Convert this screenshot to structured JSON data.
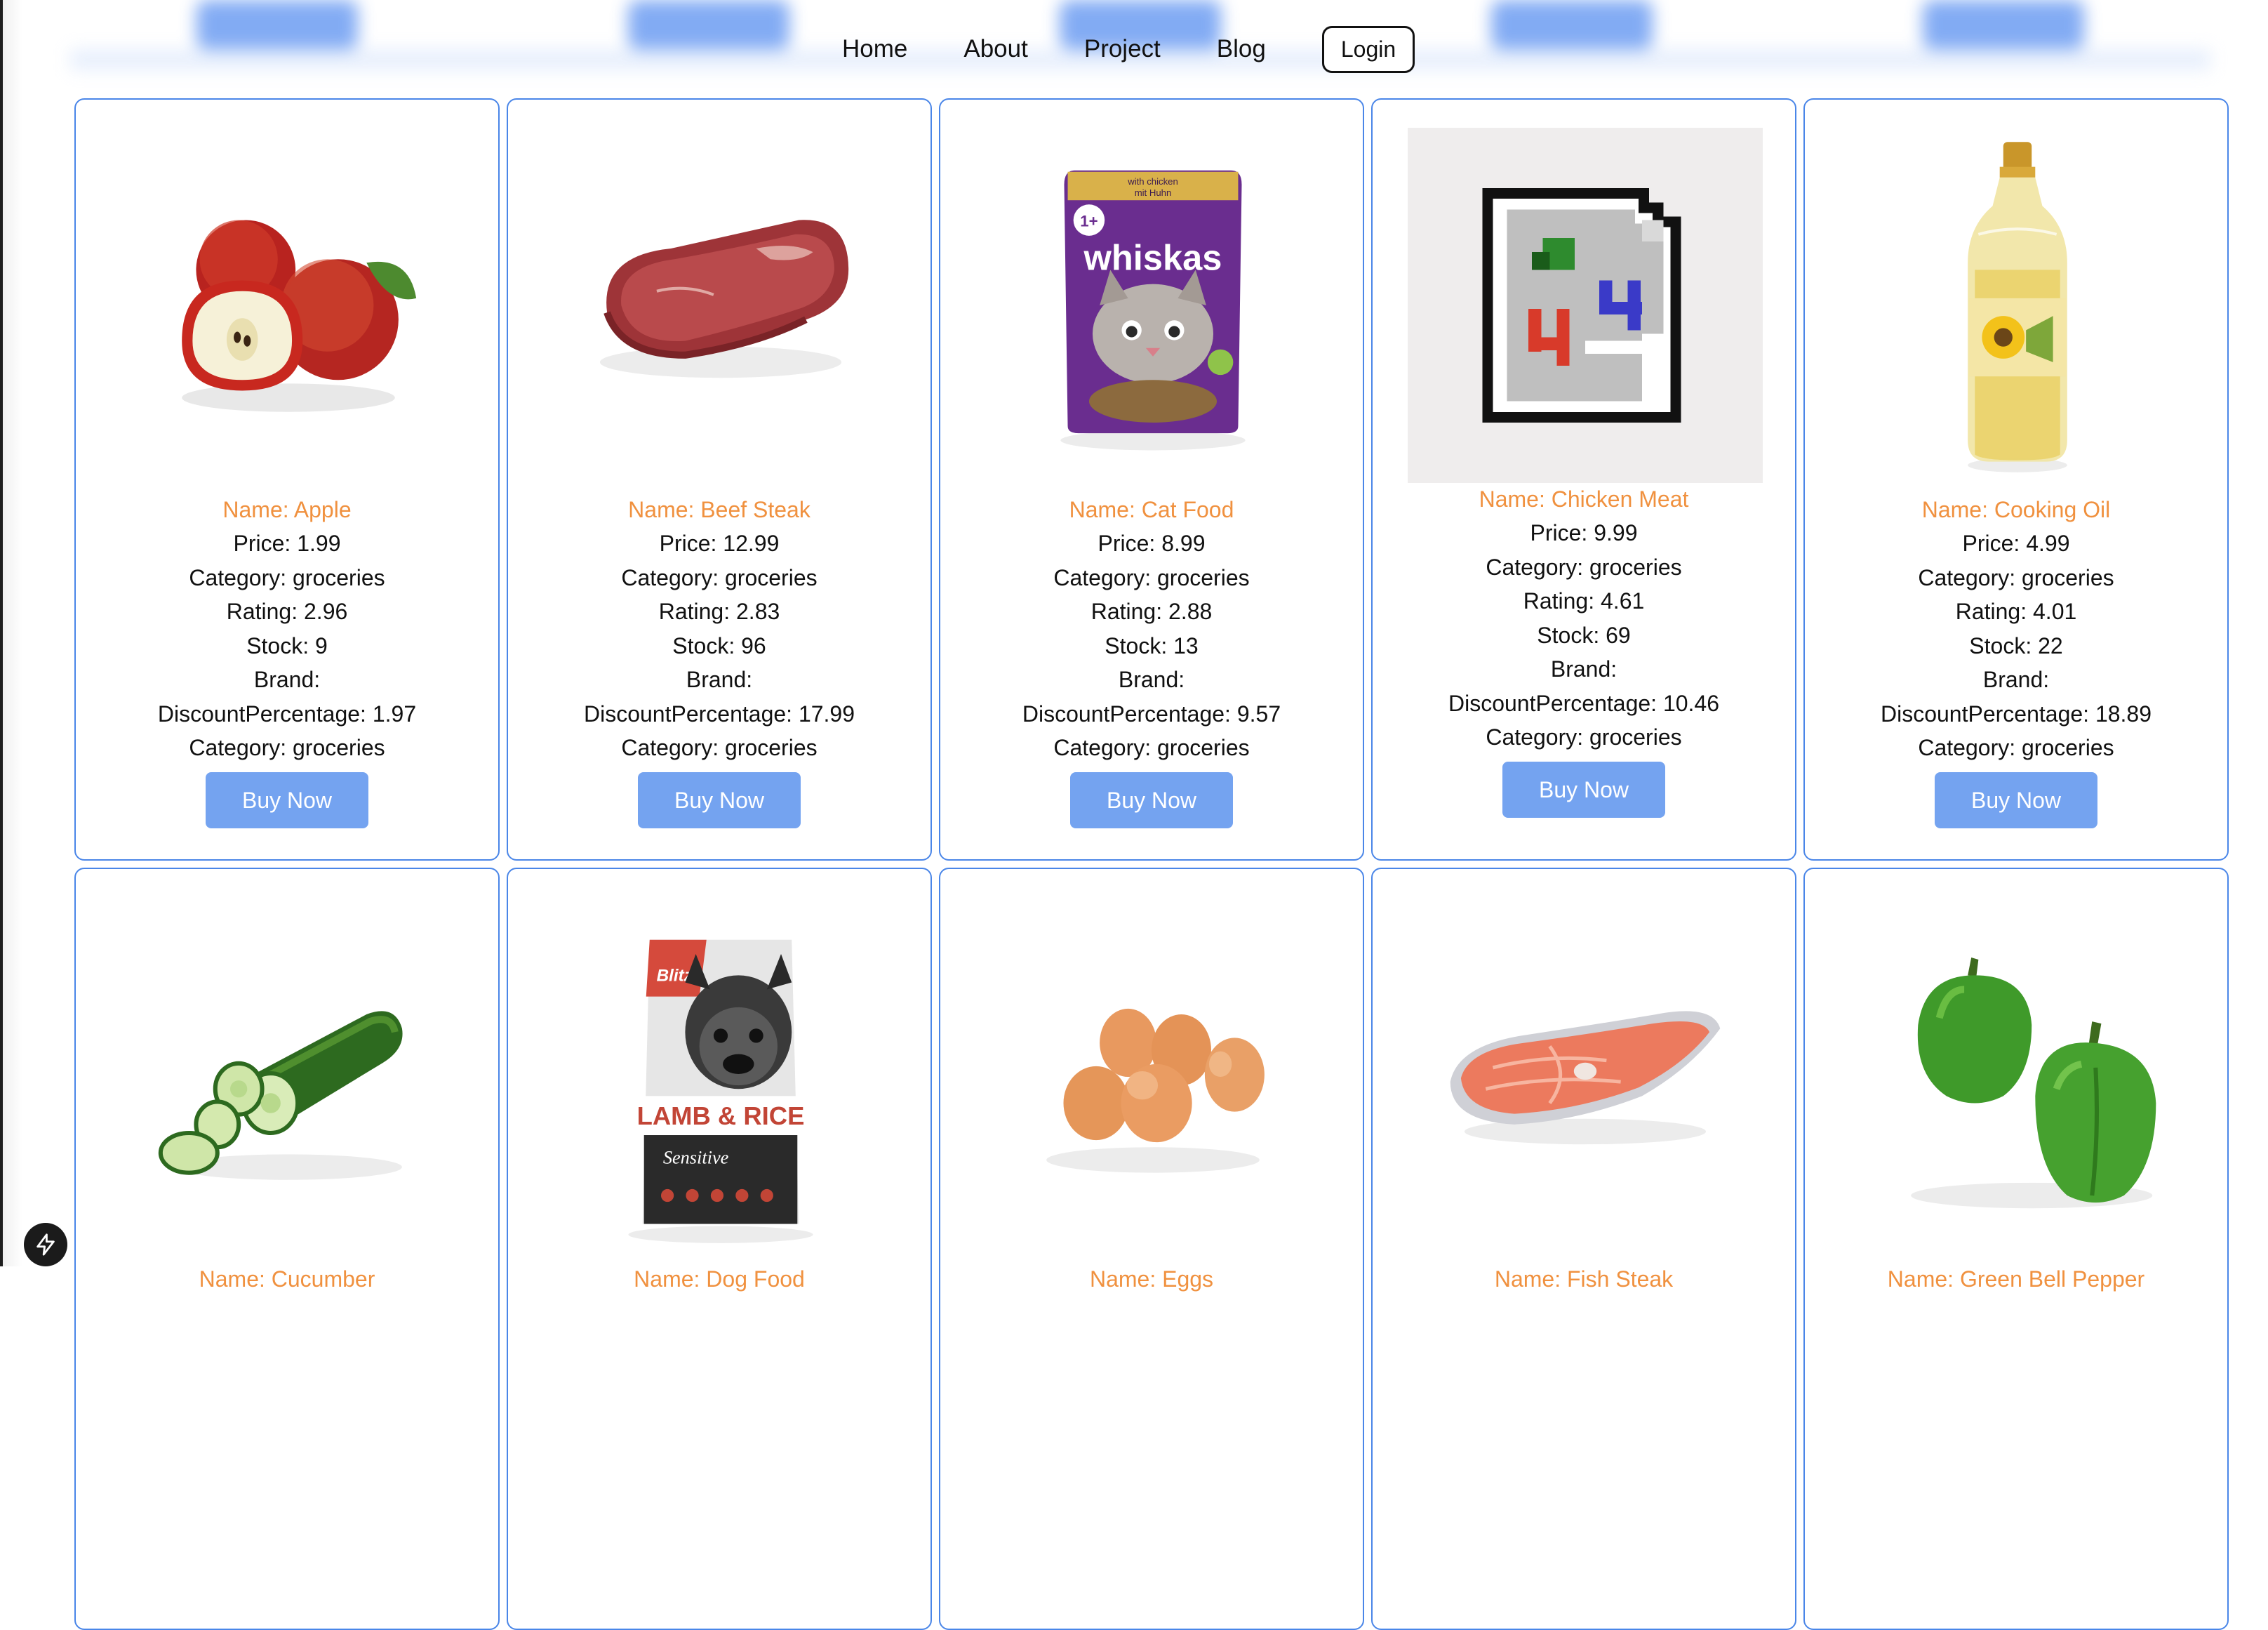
{
  "nav": {
    "links": [
      "Home",
      "About",
      "Project",
      "Blog"
    ],
    "login": "Login"
  },
  "products": [
    {
      "name": "Name: Apple",
      "price": "Price: 1.99",
      "category": "Category: groceries",
      "rating": "Rating: 2.96",
      "stock": "Stock: 9",
      "brand": "Brand:",
      "discount": "DiscountPercentage: 1.97",
      "category2": "Category: groceries",
      "buy": "Buy Now",
      "image": "apple"
    },
    {
      "name": "Name: Beef Steak",
      "price": "Price: 12.99",
      "category": "Category: groceries",
      "rating": "Rating: 2.83",
      "stock": "Stock: 96",
      "brand": "Brand:",
      "discount": "DiscountPercentage: 17.99",
      "category2": "Category: groceries",
      "buy": "Buy Now",
      "image": "beef-steak"
    },
    {
      "name": "Name: Cat Food",
      "price": "Price: 8.99",
      "category": "Category: groceries",
      "rating": "Rating: 2.88",
      "stock": "Stock: 13",
      "brand": "Brand:",
      "discount": "DiscountPercentage: 9.57",
      "category2": "Category: groceries",
      "buy": "Buy Now",
      "image": "cat-food-pouch"
    },
    {
      "name": "Name: Chicken Meat",
      "price": "Price: 9.99",
      "category": "Category: groceries",
      "rating": "Rating: 4.61",
      "stock": "Stock: 69",
      "brand": "Brand:",
      "discount": "DiscountPercentage: 10.46",
      "category2": "Category: groceries",
      "buy": "Buy Now",
      "image": "broken-image"
    },
    {
      "name": "Name: Cooking Oil",
      "price": "Price: 4.99",
      "category": "Category: groceries",
      "rating": "Rating: 4.01",
      "stock": "Stock: 22",
      "brand": "Brand:",
      "discount": "DiscountPercentage: 18.89",
      "category2": "Category: groceries",
      "buy": "Buy Now",
      "image": "oil-bottle"
    },
    {
      "name": "Name: Cucumber",
      "image": "cucumber"
    },
    {
      "name": "Name: Dog Food",
      "image": "dog-food-bag"
    },
    {
      "name": "Name: Eggs",
      "image": "eggs"
    },
    {
      "name": "Name: Fish Steak",
      "image": "fish-steak"
    },
    {
      "name": "Name: Green Bell Pepper",
      "image": "green-peppers"
    }
  ],
  "packaging": {
    "cat_food_brand": "whiskas",
    "cat_food_age": "1+",
    "cat_food_flavor_line1": "with chicken",
    "cat_food_flavor_line2": "mit Huhn",
    "dog_food_brand": "Blitz",
    "dog_food_line": "LAMB & RICE",
    "dog_food_sub": "Sensitive"
  },
  "colors": {
    "card_border": "#4a86e8",
    "name_text": "#f0913f",
    "buy_button": "#74a3f0"
  }
}
